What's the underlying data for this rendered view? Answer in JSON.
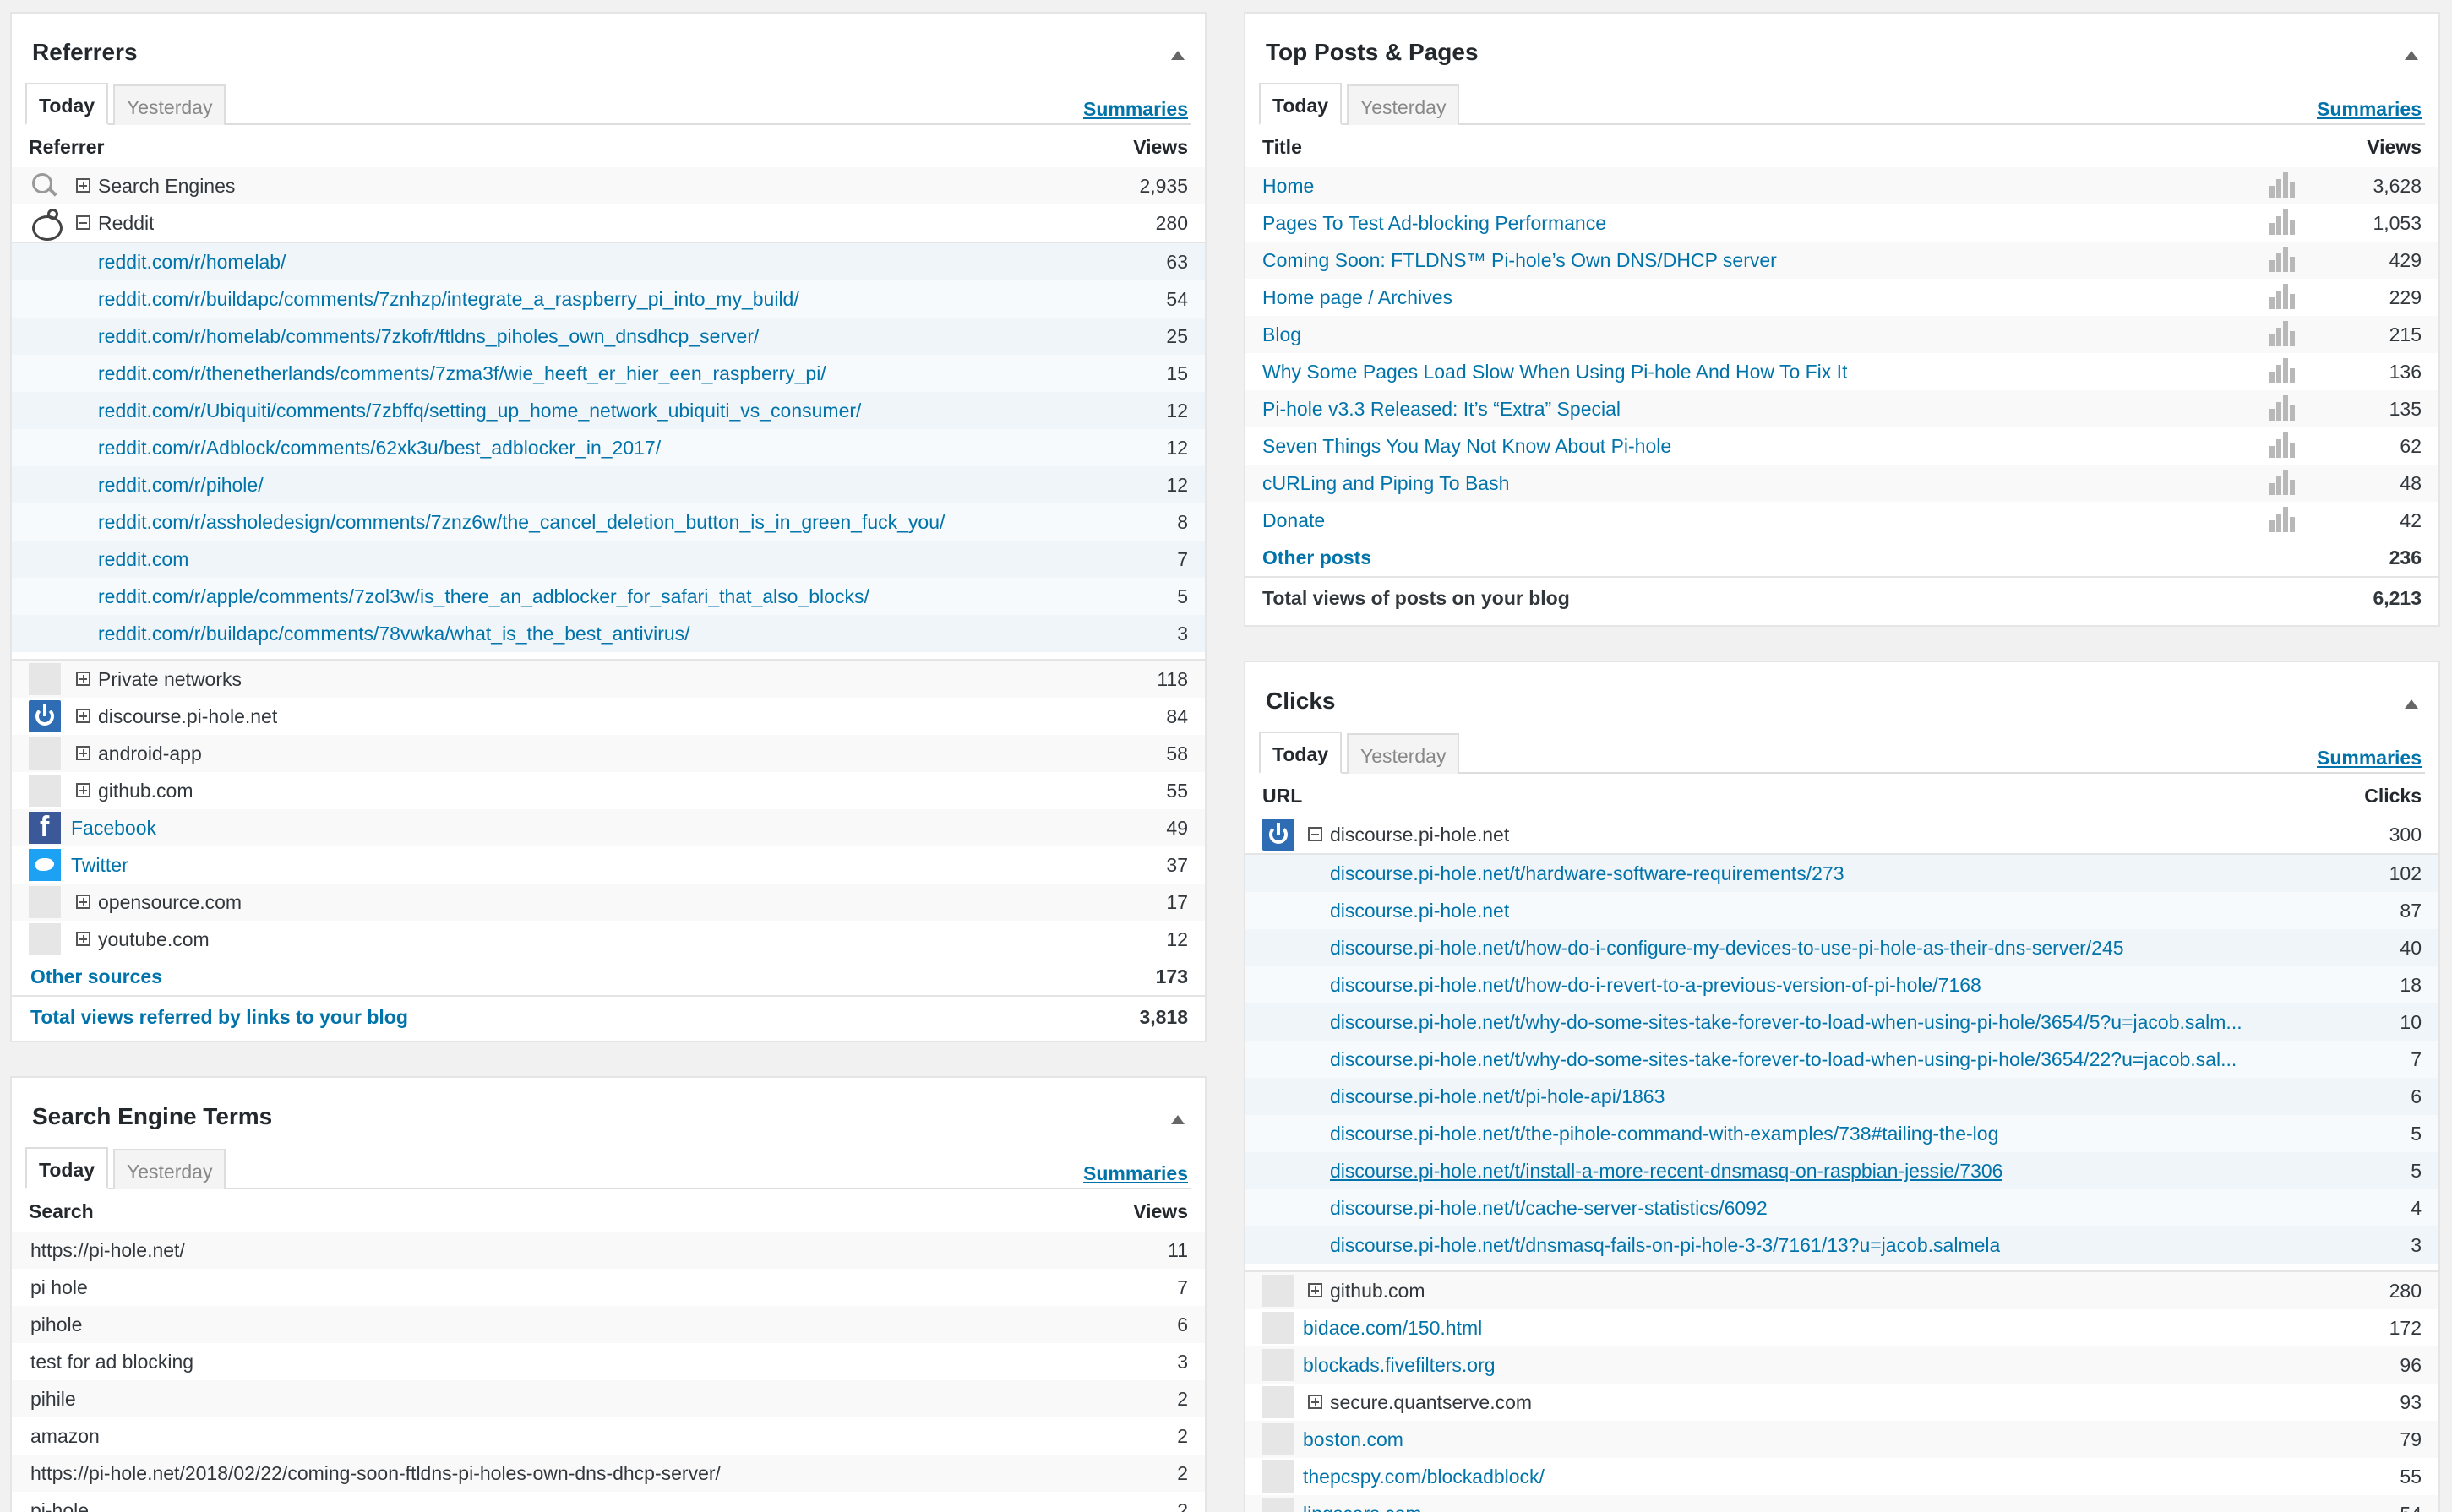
{
  "common": {
    "tab_today": "Today",
    "tab_yesterday": "Yesterday",
    "summaries": "Summaries"
  },
  "referrers": {
    "title": "Referrers",
    "col_left": "Referrer",
    "col_right": "Views",
    "rows": [
      {
        "label": "Search Engines",
        "value": "2,935",
        "icon": "search-icon",
        "expander": "plus"
      },
      {
        "label": "Reddit",
        "value": "280",
        "icon": "reddit-icon",
        "expander": "minus"
      }
    ],
    "reddit_children": [
      {
        "label": "reddit.com/r/homelab/",
        "value": "63"
      },
      {
        "label": "reddit.com/r/buildapc/comments/7znhzp/integrate_a_raspberry_pi_into_my_build/",
        "value": "54"
      },
      {
        "label": "reddit.com/r/homelab/comments/7zkofr/ftldns_piholes_own_dnsdhcp_server/",
        "value": "25"
      },
      {
        "label": "reddit.com/r/thenetherlands/comments/7zma3f/wie_heeft_er_hier_een_raspberry_pi/",
        "value": "15"
      },
      {
        "label": "reddit.com/r/Ubiquiti/comments/7zbffq/setting_up_home_network_ubiquiti_vs_consumer/",
        "value": "12"
      },
      {
        "label": "reddit.com/r/Adblock/comments/62xk3u/best_adblocker_in_2017/",
        "value": "12"
      },
      {
        "label": "reddit.com/r/pihole/",
        "value": "12"
      },
      {
        "label": "reddit.com/r/assholedesign/comments/7znz6w/the_cancel_deletion_button_is_in_green_fuck_you/",
        "value": "8"
      },
      {
        "label": "reddit.com",
        "value": "7"
      },
      {
        "label": "reddit.com/r/apple/comments/7zol3w/is_there_an_adblocker_for_safari_that_also_blocks/",
        "value": "5"
      },
      {
        "label": "reddit.com/r/buildapc/comments/78vwka/what_is_the_best_antivirus/",
        "value": "3"
      }
    ],
    "rows2": [
      {
        "label": "Private networks",
        "value": "118",
        "icon": "blank",
        "expander": "plus",
        "link": false
      },
      {
        "label": "discourse.pi-hole.net",
        "value": "84",
        "icon": "power",
        "expander": "plus",
        "link": false
      },
      {
        "label": "android-app",
        "value": "58",
        "icon": "blank",
        "expander": "plus",
        "link": false
      },
      {
        "label": "github.com",
        "value": "55",
        "icon": "blank",
        "expander": "plus",
        "link": false
      },
      {
        "label": "Facebook",
        "value": "49",
        "icon": "fb",
        "expander": "",
        "link": true
      },
      {
        "label": "Twitter",
        "value": "37",
        "icon": "tw",
        "expander": "",
        "link": true
      },
      {
        "label": "opensource.com",
        "value": "17",
        "icon": "blank",
        "expander": "plus",
        "link": false
      },
      {
        "label": "youtube.com",
        "value": "12",
        "icon": "blank",
        "expander": "plus",
        "link": false
      }
    ],
    "other_label": "Other sources",
    "other_value": "173",
    "total_label": "Total views referred by links to your blog",
    "total_value": "3,818"
  },
  "search_terms": {
    "title": "Search Engine Terms",
    "col_left": "Search",
    "col_right": "Views",
    "rows": [
      {
        "label": "https://pi-hole.net/",
        "value": "11"
      },
      {
        "label": "pi hole",
        "value": "7"
      },
      {
        "label": "pihole",
        "value": "6"
      },
      {
        "label": "test for ad blocking",
        "value": "3"
      },
      {
        "label": "pihile",
        "value": "2"
      },
      {
        "label": "amazon",
        "value": "2"
      },
      {
        "label": "https://pi-hole.net/2018/02/22/coming-soon-ftldns-pi-holes-own-dns-dhcp-server/",
        "value": "2"
      },
      {
        "label": "pi-hole",
        "value": "2"
      }
    ]
  },
  "top_posts": {
    "title": "Top Posts & Pages",
    "col_left": "Title",
    "col_right": "Views",
    "rows": [
      {
        "label": "Home",
        "value": "3,628"
      },
      {
        "label": "Pages To Test Ad-blocking Performance",
        "value": "1,053"
      },
      {
        "label": "Coming Soon: FTLDNS™ Pi-hole’s Own DNS/DHCP server",
        "value": "429"
      },
      {
        "label": "Home page / Archives",
        "value": "229"
      },
      {
        "label": "Blog",
        "value": "215"
      },
      {
        "label": "Why Some Pages Load Slow When Using Pi-hole And How To Fix It",
        "value": "136"
      },
      {
        "label": "Pi-hole v3.3 Released: It’s “Extra” Special",
        "value": "135"
      },
      {
        "label": "Seven Things You May Not Know About Pi-hole",
        "value": "62"
      },
      {
        "label": "cURLing and Piping To Bash",
        "value": "48"
      },
      {
        "label": "Donate",
        "value": "42"
      }
    ],
    "other_label": "Other posts",
    "other_value": "236",
    "total_label": "Total views of posts on your blog",
    "total_value": "6,213"
  },
  "clicks": {
    "title": "Clicks",
    "col_left": "URL",
    "col_right": "Clicks",
    "parent": {
      "label": "discourse.pi-hole.net",
      "value": "300"
    },
    "children": [
      {
        "label": "discourse.pi-hole.net/t/hardware-software-requirements/273",
        "value": "102"
      },
      {
        "label": "discourse.pi-hole.net",
        "value": "87"
      },
      {
        "label": "discourse.pi-hole.net/t/how-do-i-configure-my-devices-to-use-pi-hole-as-their-dns-server/245",
        "value": "40"
      },
      {
        "label": "discourse.pi-hole.net/t/how-do-i-revert-to-a-previous-version-of-pi-hole/7168",
        "value": "18"
      },
      {
        "label": "discourse.pi-hole.net/t/why-do-some-sites-take-forever-to-load-when-using-pi-hole/3654/5?u=jacob.salm...",
        "value": "10"
      },
      {
        "label": "discourse.pi-hole.net/t/why-do-some-sites-take-forever-to-load-when-using-pi-hole/3654/22?u=jacob.sal...",
        "value": "7"
      },
      {
        "label": "discourse.pi-hole.net/t/pi-hole-api/1863",
        "value": "6"
      },
      {
        "label": "discourse.pi-hole.net/t/the-pihole-command-with-examples/738#tailing-the-log",
        "value": "5"
      },
      {
        "label": "discourse.pi-hole.net/t/install-a-more-recent-dnsmasq-on-raspbian-jessie/7306",
        "value": "5"
      },
      {
        "label": "discourse.pi-hole.net/t/cache-server-statistics/6092",
        "value": "4"
      },
      {
        "label": "discourse.pi-hole.net/t/dnsmasq-fails-on-pi-hole-3-3/7161/13?u=jacob.salmela",
        "value": "3"
      }
    ],
    "rows2": [
      {
        "label": "github.com",
        "value": "280",
        "expander": "plus",
        "link": false
      },
      {
        "label": "bidace.com/150.html",
        "value": "172",
        "expander": "",
        "link": true
      },
      {
        "label": "blockads.fivefilters.org",
        "value": "96",
        "expander": "",
        "link": true
      },
      {
        "label": "secure.quantserve.com",
        "value": "93",
        "expander": "plus",
        "link": false
      },
      {
        "label": "boston.com",
        "value": "79",
        "expander": "",
        "link": true
      },
      {
        "label": "thepcspy.com/blockadblock/",
        "value": "55",
        "expander": "",
        "link": true
      },
      {
        "label": "lingscars.com",
        "value": "54",
        "expander": "",
        "link": true
      }
    ]
  }
}
